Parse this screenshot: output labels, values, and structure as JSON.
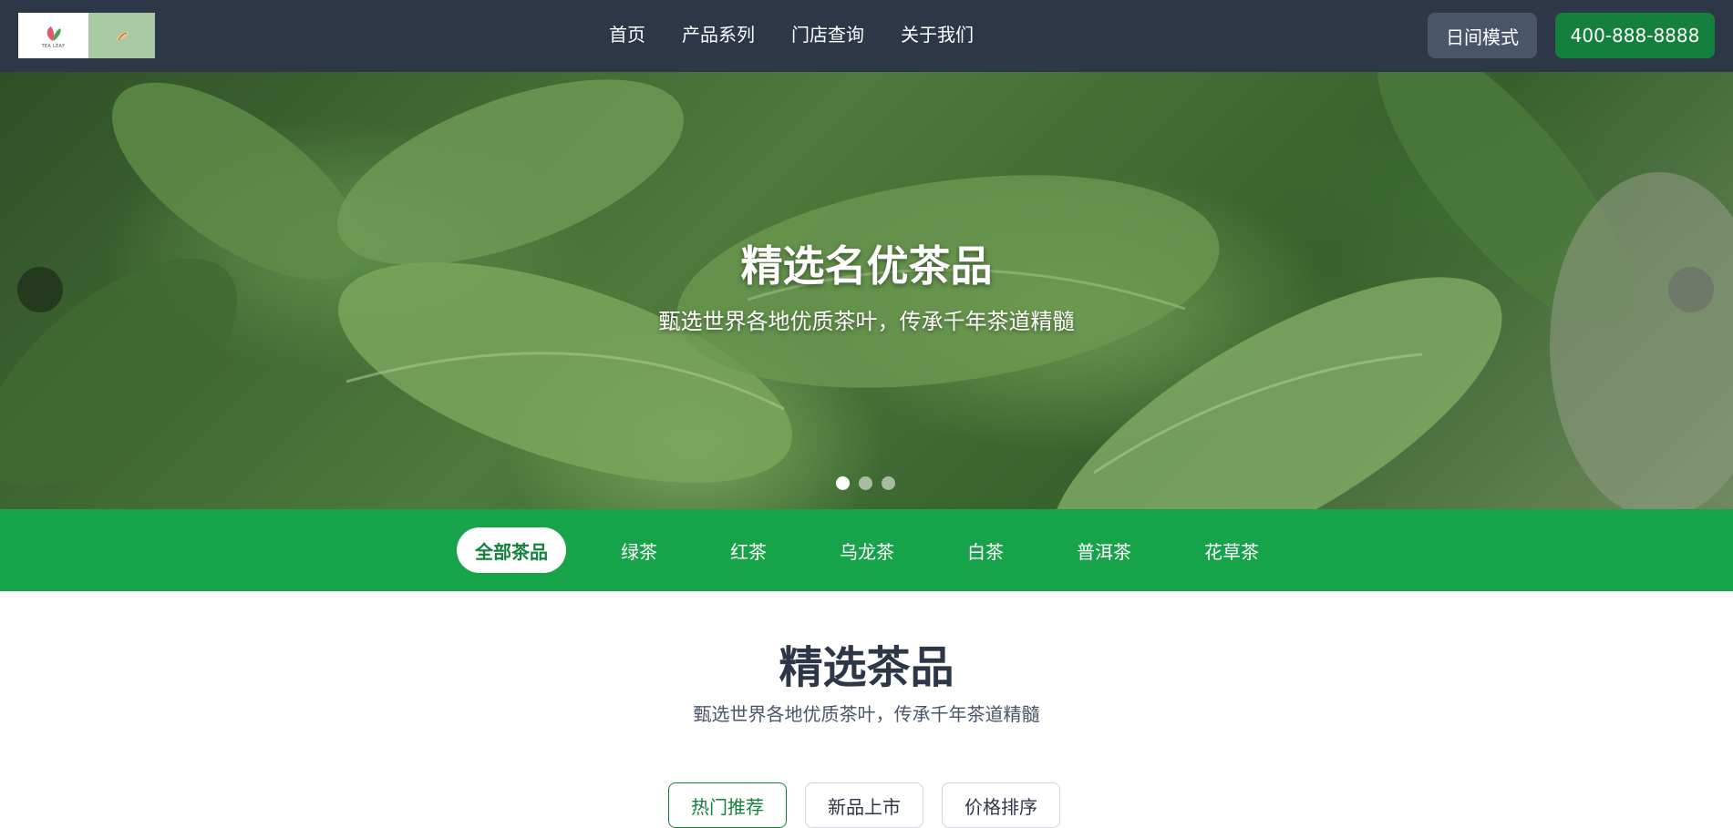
{
  "header": {
    "logo_text": "TEA LEAF",
    "nav": [
      "首页",
      "产品系列",
      "门店查询",
      "关于我们"
    ],
    "mode_button": "日间模式",
    "phone_button": "400-888-8888"
  },
  "hero": {
    "title": "精选名优茶品",
    "subtitle": "甄选世界各地优质茶叶，传承千年茶道精髓",
    "slide_count": 3,
    "active_slide": 1
  },
  "categories": {
    "items": [
      "全部茶品",
      "绿茶",
      "红茶",
      "乌龙茶",
      "白茶",
      "普洱茶",
      "花草茶"
    ],
    "active": "全部茶品"
  },
  "section": {
    "title": "精选茶品",
    "subtitle": "甄选世界各地优质茶叶，传承千年茶道精髓",
    "sort_tabs": [
      "热门推荐",
      "新品上市",
      "价格排序"
    ],
    "active_sort": "热门推荐"
  },
  "colors": {
    "header_bg": "#2d3748",
    "accent_green": "#16a34a",
    "phone_button": "#15803d"
  }
}
